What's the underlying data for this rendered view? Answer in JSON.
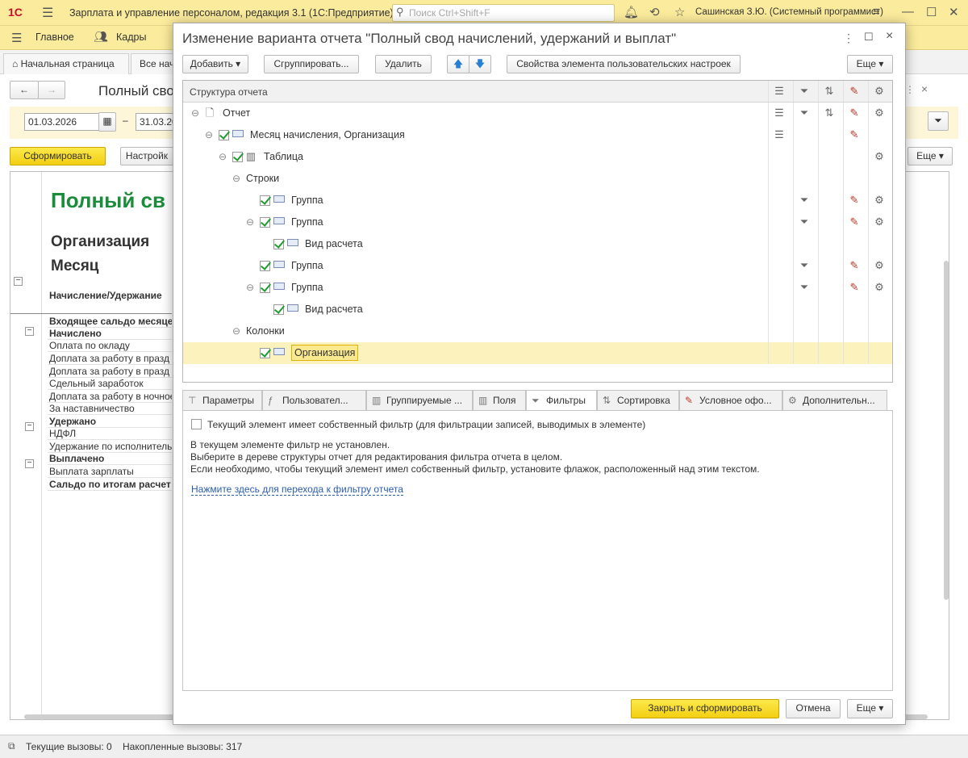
{
  "titlebar": {
    "logo": "1С",
    "app_title": "Зарплата и управление персоналом, редакция 3.1  (1С:Предприятие)",
    "search_placeholder": "Поиск Ctrl+Shift+F",
    "user": "Сашинская З.Ю. (Системный программист)"
  },
  "sections": [
    "Главное",
    "Кадры"
  ],
  "tabs": [
    "Начальная страница",
    "Все нач"
  ],
  "report": {
    "title": "Полный свод",
    "date_from": "01.03.2026",
    "date_to": "31.03.20",
    "generate_label": "Сформировать",
    "settings_label": "Настройк",
    "more_label": "Еще",
    "heading": "Полный св",
    "org_label": "Организация",
    "month_label": "Месяц",
    "col_header": "Начисление/Удержание",
    "lines": [
      {
        "text": "Входящее сальдо месяце",
        "bold": true
      },
      {
        "text": "Начислено",
        "bold": true
      },
      {
        "text": "Оплата по окладу",
        "bold": false
      },
      {
        "text": "Доплата за работу в празд",
        "bold": false
      },
      {
        "text": "Доплата за работу в празд",
        "bold": false
      },
      {
        "text": "Сдельный заработок",
        "bold": false
      },
      {
        "text": "Доплата за работу в ночное",
        "bold": false
      },
      {
        "text": "За наставничество",
        "bold": false
      },
      {
        "text": "Удержано",
        "bold": true
      },
      {
        "text": "НДФЛ",
        "bold": false
      },
      {
        "text": "Удержание по исполнитель",
        "bold": false
      },
      {
        "text": "Выплачено",
        "bold": true
      },
      {
        "text": "Выплата зарплаты",
        "bold": false
      },
      {
        "text": "Сальдо по итогам расчет",
        "bold": true
      }
    ]
  },
  "status": {
    "current_calls": "Текущие вызовы: 0",
    "accumulated_calls": "Накопленные вызовы: 317"
  },
  "dialog": {
    "title": "Изменение варианта отчета \"Полный свод начислений, удержаний и выплат\"",
    "toolbar": {
      "add": "Добавить",
      "group": "Сгруппировать...",
      "delete": "Удалить",
      "props": "Свойства элемента пользовательских настроек",
      "more": "Еще"
    },
    "tree_header": "Структура отчета",
    "tree": [
      {
        "label": "Отчет",
        "level": 0,
        "check": false,
        "icon": "report"
      },
      {
        "label": "Месяц начисления, Организация",
        "level": 1,
        "check": true,
        "icon": "group"
      },
      {
        "label": "Таблица",
        "level": 2,
        "check": true,
        "icon": "table"
      },
      {
        "label": "Строки",
        "level": 3,
        "check": false,
        "icon": "none"
      },
      {
        "label": "Группа",
        "level": 4,
        "check": true,
        "icon": "group"
      },
      {
        "label": "Группа",
        "level": 4,
        "check": true,
        "icon": "group"
      },
      {
        "label": "Вид расчета",
        "level": 5,
        "check": true,
        "icon": "group"
      },
      {
        "label": "Группа",
        "level": 4,
        "check": true,
        "icon": "group"
      },
      {
        "label": "Группа",
        "level": 4,
        "check": true,
        "icon": "group"
      },
      {
        "label": "Вид расчета",
        "level": 5,
        "check": true,
        "icon": "group"
      },
      {
        "label": "Колонки",
        "level": 3,
        "check": false,
        "icon": "none"
      },
      {
        "label": "Организация",
        "level": 4,
        "check": true,
        "icon": "group"
      }
    ],
    "tabs": [
      "Параметры",
      "Пользовательские",
      "Группируемые поля",
      "Поля",
      "Фильтры",
      "Сортировка",
      "Условное оформление",
      "Дополнительные"
    ],
    "tabs_display": [
      "Параметры",
      "Пользовател...",
      "Группируемые ...",
      "Поля",
      "Фильтры",
      "Сортировка",
      "Условное офо...",
      "Дополнительн..."
    ],
    "own_filter_label": "Текущий элемент имеет собственный фильтр (для фильтрации записей, выводимых в элементе)",
    "info_lines": [
      "В текущем элементе фильтр не установлен.",
      "Выберите в дереве структуры отчет для редактирования фильтра отчета в целом.",
      "Если необходимо, чтобы текущий элемент имел собственный фильтр, установите флажок, расположенный над этим текстом."
    ],
    "link": "Нажмите здесь для перехода к фильтру отчета",
    "close_generate": "Закрыть и сформировать",
    "cancel": "Отмена",
    "more": "Еще"
  },
  "colors": {
    "accent_yellow": "#fbeb9c",
    "button_yellow": "#f3cf12",
    "green_text": "#1a8c3a"
  }
}
